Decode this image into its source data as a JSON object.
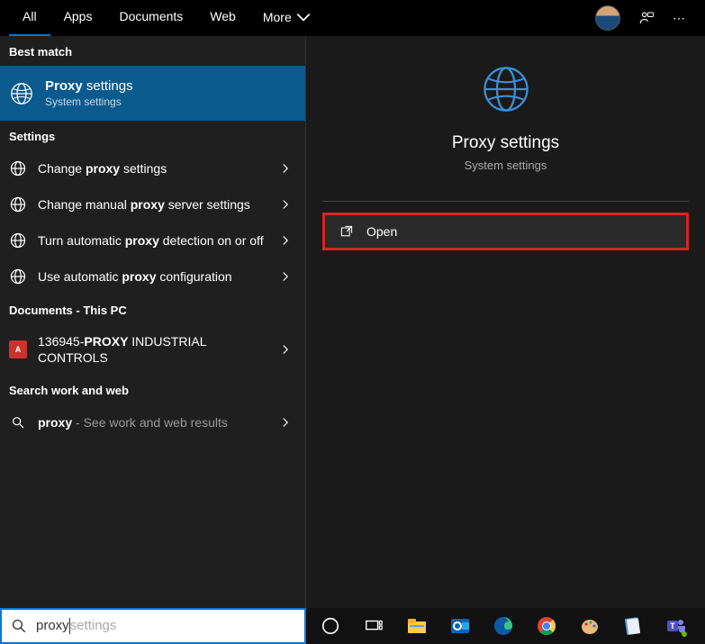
{
  "tabs": {
    "all": "All",
    "apps": "Apps",
    "documents": "Documents",
    "web": "Web",
    "more": "More"
  },
  "sections": {
    "best_match": "Best match",
    "settings": "Settings",
    "documents_pc": "Documents - This PC",
    "work_web": "Search work and web"
  },
  "best_match": {
    "title_bold": "Proxy",
    "title_rest": " settings",
    "subtitle": "System settings"
  },
  "settings_items": [
    {
      "pre": "Change ",
      "bold": "proxy",
      "post": " settings"
    },
    {
      "pre": "Change manual ",
      "bold": "proxy",
      "post": " server settings"
    },
    {
      "pre": "Turn automatic ",
      "bold": "proxy",
      "post": " detection on or off"
    },
    {
      "pre": "Use automatic ",
      "bold": "proxy",
      "post": " configuration"
    }
  ],
  "document_item": {
    "pre": "136945-",
    "bold": "PROXY",
    "post": " INDUSTRIAL CONTROLS"
  },
  "workweb_item": {
    "bold": "proxy",
    "post": " - See work and web results"
  },
  "preview": {
    "title": "Proxy settings",
    "subtitle": "System settings",
    "open": "Open"
  },
  "search": {
    "typed": "proxy",
    "ghost": "settings",
    "placeholder": ""
  },
  "icons": {
    "globe": "globe-icon",
    "pdf": "pdf-icon",
    "search": "search-icon",
    "chevron": "chevron-right-icon",
    "chevron_down": "chevron-down-icon",
    "person_chat": "person-chat-icon",
    "open": "open-icon",
    "cortana": "cortana-icon",
    "taskview": "taskview-icon",
    "explorer": "explorer-icon",
    "outlook": "outlook-icon",
    "edge": "edge-icon",
    "chrome": "chrome-icon",
    "paint": "paint-icon",
    "notepad": "notepad-icon",
    "teams": "teams-icon"
  },
  "colors": {
    "accent": "#0078d4",
    "highlight": "#d22",
    "selected_bg": "#0a5a8e"
  }
}
